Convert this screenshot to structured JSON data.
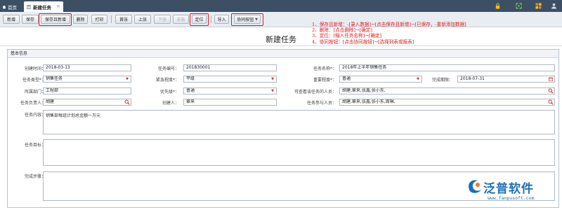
{
  "tabs": {
    "home_label": "首页",
    "active_label": "新建任务",
    "close_glyph": "×"
  },
  "toolbar": {
    "buttons": [
      "新增",
      "保存",
      "保存且新增",
      "删除",
      "打印",
      "首张",
      "上张",
      "下张",
      "末张",
      "定位",
      "导入",
      "协同按钮"
    ]
  },
  "notes": {
    "line1": "1、保存且新增：-[录入数据]→[点击保存且新增]→[已保存，-重新添加数据]",
    "line2": "2、删除：[点击删除]→[确定]",
    "line3": "3、定位：[输入任务名称]→[确定]",
    "line4": "4、协同按钮：[点击协同按钮]→[选择列表或报表]"
  },
  "page": {
    "title": "新建任务"
  },
  "form": {
    "section_title": "基本信息",
    "create_time_label": "创建时间：",
    "create_time_value": "2018-03-13",
    "task_no_label": "任务编号：",
    "task_no_value": "201830001",
    "task_name_label": "任务名称*：",
    "task_name_value": "2018年上半年销售任务",
    "task_type_label": "任务类型*：",
    "task_type_value": "销售任务",
    "urgency_label": "紧急程度*：",
    "urgency_value": "平级",
    "importance_label": "重要程度*：",
    "importance_value": "普通",
    "deadline_label": "完成期限：",
    "deadline_value": "2018-07-31",
    "dept_label": "所属部门：",
    "dept_value": "工程部",
    "priority_label": "优先级*：",
    "priority_value": "普通",
    "viewers_label": "可查看该任务的人员：",
    "viewers_value": "胡建,章来,张鑫,张小东,",
    "owner_label": "任务负责人：",
    "owner_value": "胡建",
    "creator_label": "创建人：",
    "creator_value": "章来",
    "participants_label": "任务参与人员：",
    "participants_value": "胡建,章来,张鑫,张小东,周琳,",
    "content_label": "任务内容：",
    "content_value": "销售部每组计划总金额一万元",
    "goal_label": "任务目标：",
    "goal_value": "",
    "steps_label": "完成步骤：",
    "steps_value": ""
  },
  "logo": {
    "name": "泛普软件",
    "url": "www.fanpusoft.com"
  },
  "colors": {
    "topbar": "#3d4f63",
    "highlight": "#e0161b",
    "brand": "#1d6fb8"
  }
}
